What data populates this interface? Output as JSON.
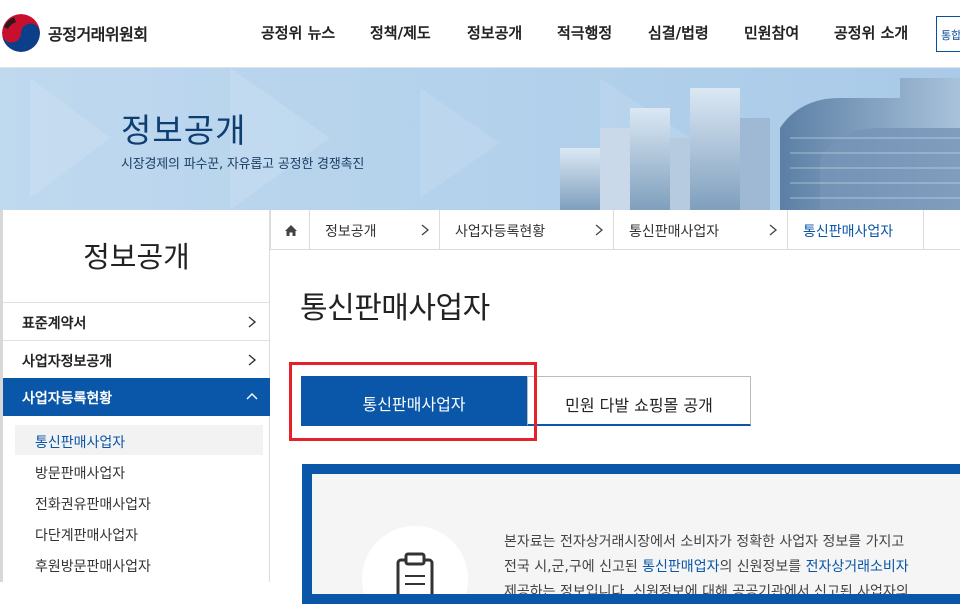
{
  "header": {
    "org_name": "공정거래위원회",
    "nav": [
      {
        "label": "공정위 뉴스"
      },
      {
        "label": "정책/제도"
      },
      {
        "label": "정보공개"
      },
      {
        "label": "적극행정"
      },
      {
        "label": "심결/법령"
      },
      {
        "label": "민원참여"
      },
      {
        "label": "공정위 소개"
      }
    ],
    "extra_button": "통합"
  },
  "banner": {
    "title": "정보공개",
    "subtitle": "시장경제의 파수꾼, 자유롭고 공정한 경쟁촉진"
  },
  "sidebar": {
    "title": "정보공개",
    "items": [
      {
        "label": "표준계약서"
      },
      {
        "label": "사업자정보공개"
      },
      {
        "label": "사업자등록현황"
      }
    ],
    "subitems": [
      {
        "label": "통신판매사업자"
      },
      {
        "label": "방문판매사업자"
      },
      {
        "label": "전화권유판매사업자"
      },
      {
        "label": "다단계판매사업자"
      },
      {
        "label": "후원방문판매사업자"
      }
    ]
  },
  "breadcrumb": [
    {
      "label": "정보공개"
    },
    {
      "label": "사업자등록현황"
    },
    {
      "label": "통신판매사업자"
    },
    {
      "label": "통신판매사업자"
    }
  ],
  "main": {
    "title": "통신판매사업자",
    "tabs": [
      {
        "label": "통신판매사업자"
      },
      {
        "label": "민원 다발 쇼핑몰 공개"
      }
    ],
    "info": {
      "line1": "본자료는 전자상거래시장에서 소비자가 정확한 사업자 정보를 가지고",
      "line2_a": "전국 시,군,구에 신고된 ",
      "line2_b": "통신판매업자",
      "line2_c": "의 신원정보를 ",
      "line2_d": "전자상거래소비자",
      "line3": "제공하는 정보입니다. 신원정보에 대해 공공기관에서 신고된 사업자의"
    }
  },
  "colors": {
    "primary": "#0a56a8",
    "highlight": "#e62129",
    "banner_title": "#0e3d72"
  }
}
